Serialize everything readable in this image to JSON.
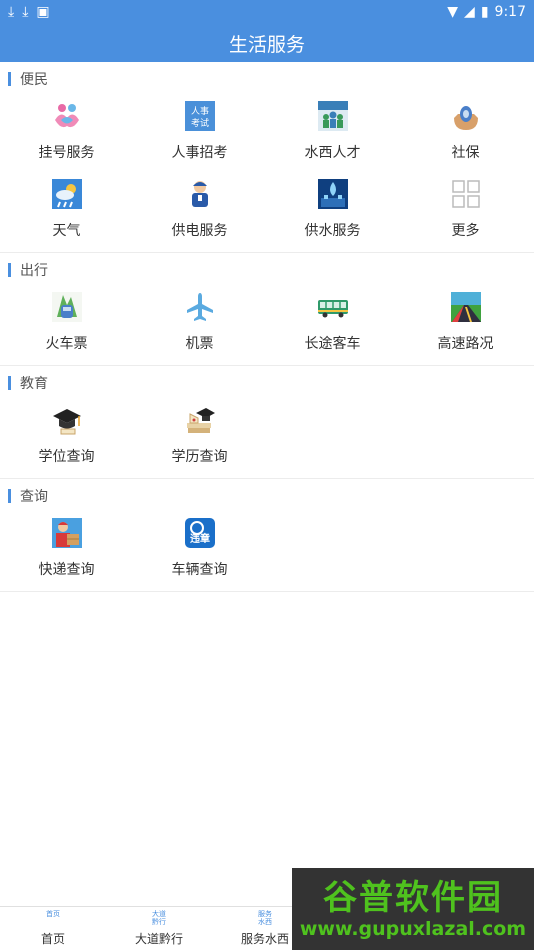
{
  "status_bar": {
    "time": "9:17"
  },
  "app_bar": {
    "title": "生活服务"
  },
  "sections": [
    {
      "title": "便民",
      "items": [
        {
          "label": "挂号服务",
          "icon": "hospital-registration-icon"
        },
        {
          "label": "人事招考",
          "icon": "personnel-exam-icon",
          "icon_text": "人事考试"
        },
        {
          "label": "水西人才",
          "icon": "talent-icon"
        },
        {
          "label": "社保",
          "icon": "social-security-icon"
        },
        {
          "label": "天气",
          "icon": "weather-icon"
        },
        {
          "label": "供电服务",
          "icon": "power-supply-icon"
        },
        {
          "label": "供水服务",
          "icon": "water-supply-icon"
        },
        {
          "label": "更多",
          "icon": "more-grid-icon"
        }
      ]
    },
    {
      "title": "出行",
      "items": [
        {
          "label": "火车票",
          "icon": "train-ticket-icon"
        },
        {
          "label": "机票",
          "icon": "airplane-icon"
        },
        {
          "label": "长途客车",
          "icon": "bus-icon"
        },
        {
          "label": "高速路况",
          "icon": "highway-icon"
        }
      ]
    },
    {
      "title": "教育",
      "items": [
        {
          "label": "学位查询",
          "icon": "graduation-cap-icon"
        },
        {
          "label": "学历查询",
          "icon": "diploma-books-icon"
        }
      ]
    },
    {
      "title": "查询",
      "items": [
        {
          "label": "快递查询",
          "icon": "courier-icon"
        },
        {
          "label": "车辆查询",
          "icon": "vehicle-violation-icon",
          "icon_text": "违章"
        }
      ]
    }
  ],
  "bottom_nav": [
    {
      "label": "首页",
      "icon_text": "首页"
    },
    {
      "label": "大道黔行",
      "icon_text": "大道黔行"
    },
    {
      "label": "服务水西",
      "icon_text": "服务水西"
    }
  ],
  "watermark": {
    "title": "谷普软件园",
    "url": "www.gupuxlazal.com"
  }
}
